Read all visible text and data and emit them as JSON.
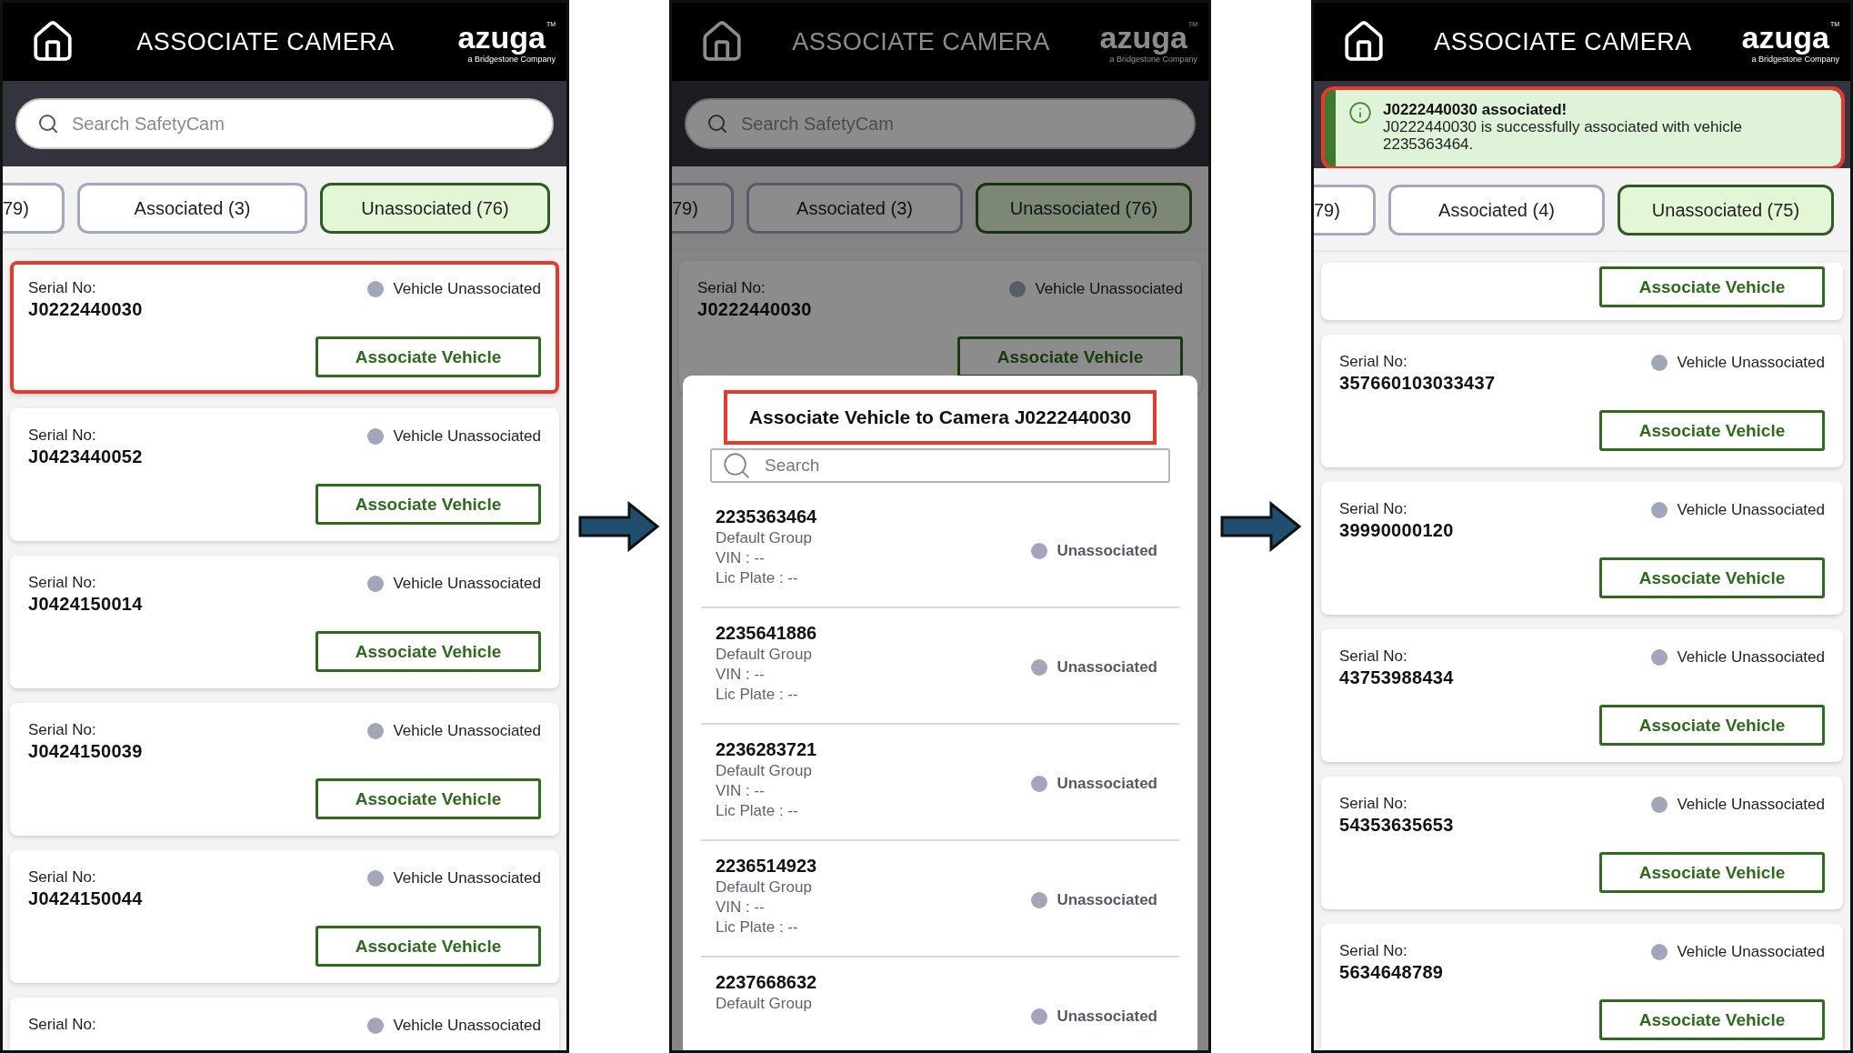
{
  "screens": [
    {
      "dimmed": false,
      "header": {
        "title": "ASSOCIATE CAMERA",
        "logo": "azuga",
        "logo_mark": "TM",
        "logo_tagline": "a Bridgestone Company"
      },
      "search": {
        "placeholder": "Search SafetyCam"
      },
      "tabs": [
        {
          "label": "79)",
          "selected": false
        },
        {
          "label": "Associated (3)",
          "selected": false
        },
        {
          "label": "Unassociated (76)",
          "selected": true
        }
      ],
      "cards": [
        {
          "serial_label": "Serial No:",
          "serial": "J0222440030",
          "status": "Vehicle Unassociated",
          "button": "Associate Vehicle",
          "highlighted": true
        },
        {
          "serial_label": "Serial No:",
          "serial": "J0423440052",
          "status": "Vehicle Unassociated",
          "button": "Associate Vehicle",
          "highlighted": false
        },
        {
          "serial_label": "Serial No:",
          "serial": "J0424150014",
          "status": "Vehicle Unassociated",
          "button": "Associate Vehicle",
          "highlighted": false
        },
        {
          "serial_label": "Serial No:",
          "serial": "J0424150039",
          "status": "Vehicle Unassociated",
          "button": "Associate Vehicle",
          "highlighted": false
        },
        {
          "serial_label": "Serial No:",
          "serial": "J0424150044",
          "status": "Vehicle Unassociated",
          "button": "Associate Vehicle",
          "highlighted": false
        },
        {
          "serial_label": "Serial No:",
          "status": "Vehicle Unassociated",
          "highlighted": false
        }
      ]
    },
    {
      "dimmed": true,
      "header": {
        "title": "ASSOCIATE CAMERA",
        "logo": "azuga",
        "logo_mark": "TM",
        "logo_tagline": "a Bridgestone Company"
      },
      "search": {
        "placeholder": "Search SafetyCam"
      },
      "tabs": [
        {
          "label": "79)",
          "selected": false
        },
        {
          "label": "Associated (3)",
          "selected": false
        },
        {
          "label": "Unassociated (76)",
          "selected": true
        }
      ],
      "cards": [
        {
          "serial_label": "Serial No:",
          "serial": "J0222440030",
          "status": "Vehicle Unassociated",
          "button": "Associate Vehicle",
          "highlighted": false
        }
      ],
      "sheet": {
        "title": "Associate Vehicle to Camera J0222440030",
        "title_highlighted": true,
        "search_placeholder": "Search",
        "vehicles": [
          {
            "number": "2235363464",
            "group": "Default Group",
            "vin": "VIN : --",
            "plate": "Lic Plate : --",
            "status": "Unassociated"
          },
          {
            "number": "2235641886",
            "group": "Default Group",
            "vin": "VIN : --",
            "plate": "Lic Plate : --",
            "status": "Unassociated"
          },
          {
            "number": "2236283721",
            "group": "Default Group",
            "vin": "VIN : --",
            "plate": "Lic Plate : --",
            "status": "Unassociated"
          },
          {
            "number": "2236514923",
            "group": "Default Group",
            "vin": "VIN : --",
            "plate": "Lic Plate : --",
            "status": "Unassociated"
          },
          {
            "number": "2237668632",
            "group": "Default Group",
            "status": "Unassociated"
          }
        ]
      }
    },
    {
      "dimmed": false,
      "header": {
        "title": "ASSOCIATE CAMERA",
        "logo": "azuga",
        "logo_mark": "TM",
        "logo_tagline": "a Bridgestone Company"
      },
      "toast": {
        "title": "J0222440030 associated!",
        "message": "J0222440030 is successfully associated with vehicle 2235363464.",
        "highlighted": true
      },
      "tabs": [
        {
          "label": "79)",
          "selected": false
        },
        {
          "label": "Associated (4)",
          "selected": false
        },
        {
          "label": "Unassociated (75)",
          "selected": true
        }
      ],
      "cards": [
        {
          "button": "Associate Vehicle",
          "highlighted": false
        },
        {
          "serial_label": "Serial No:",
          "serial": "357660103033437",
          "status": "Vehicle Unassociated",
          "button": "Associate Vehicle",
          "highlighted": false
        },
        {
          "serial_label": "Serial No:",
          "serial": "39990000120",
          "status": "Vehicle Unassociated",
          "button": "Associate Vehicle",
          "highlighted": false
        },
        {
          "serial_label": "Serial No:",
          "serial": "43753988434",
          "status": "Vehicle Unassociated",
          "button": "Associate Vehicle",
          "highlighted": false
        },
        {
          "serial_label": "Serial No:",
          "serial": "54353635653",
          "status": "Vehicle Unassociated",
          "button": "Associate Vehicle",
          "highlighted": false
        },
        {
          "serial_label": "Serial No:",
          "serial": "5634648789",
          "status": "Vehicle Unassociated",
          "button": "Associate Vehicle",
          "highlighted": false
        }
      ]
    }
  ]
}
